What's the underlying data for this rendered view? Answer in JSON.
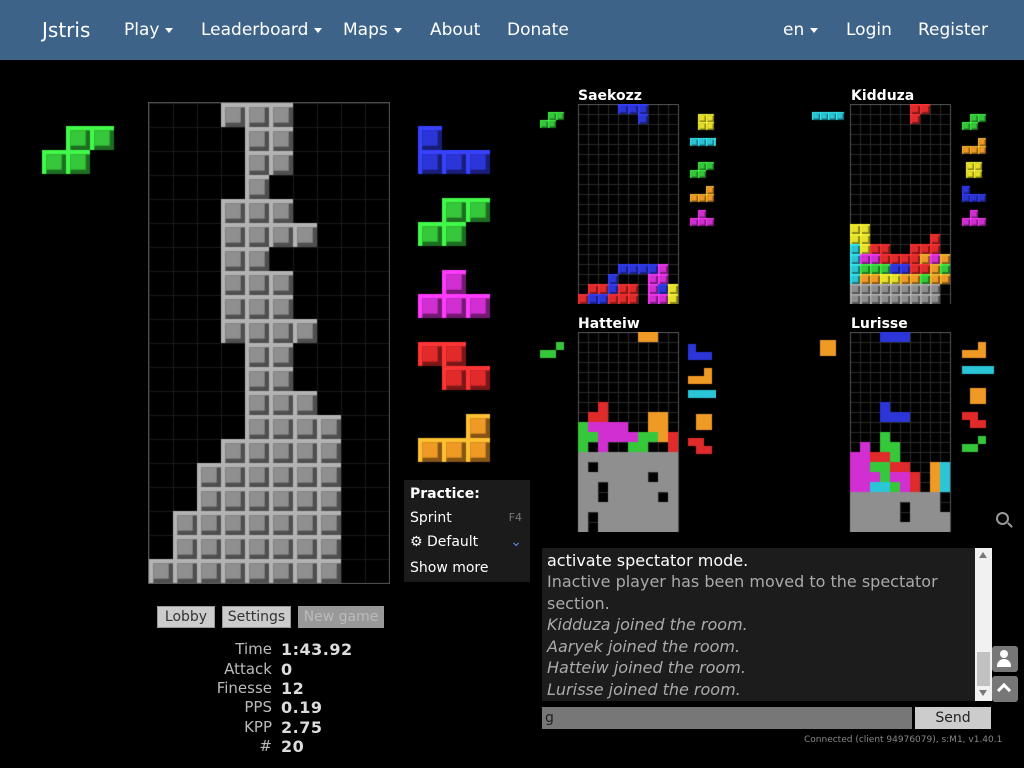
{
  "nav": {
    "brand": "Jstris",
    "play": "Play",
    "leaderboard": "Leaderboard",
    "maps": "Maps",
    "about": "About",
    "donate": "Donate",
    "lang": "en",
    "login": "Login",
    "register": "Register"
  },
  "players": [
    "Saekozz",
    "Kidduza",
    "Hatteiw",
    "Lurisse"
  ],
  "practice": {
    "title": "Practice:",
    "sprint": "Sprint",
    "sprint_key": "F4",
    "default": "Default",
    "show_more": "Show more"
  },
  "buttons": {
    "lobby": "Lobby",
    "settings": "Settings",
    "new_game": "New game"
  },
  "stats": [
    {
      "label": "Time",
      "value": "1:43.92"
    },
    {
      "label": "Attack",
      "value": "0"
    },
    {
      "label": "Finesse",
      "value": "12"
    },
    {
      "label": "PPS",
      "value": "0.19"
    },
    {
      "label": "KPP",
      "value": "2.75"
    },
    {
      "label": "#",
      "value": "20"
    }
  ],
  "chat": {
    "lines": [
      "activate spectator mode.",
      "Inactive player has been moved to the spectator",
      "section.",
      "Kidduza joined the room.",
      "Aaryek joined the room.",
      "Hatteiw joined the room.",
      "Lurisse joined the room."
    ],
    "input_value": "g",
    "send": "Send",
    "footer": "Connected (client 94976079), s:M1, v1.40.1"
  },
  "colors": {
    "nav": "#3e6389",
    "grey": "#8f8f8f",
    "green": "#35c83a",
    "blue": "#2c35d8",
    "magenta": "#d12fd1",
    "red": "#e12a2a",
    "orange": "#f09a26",
    "yellow": "#e8e12a",
    "cyan": "#2bc5d8"
  }
}
